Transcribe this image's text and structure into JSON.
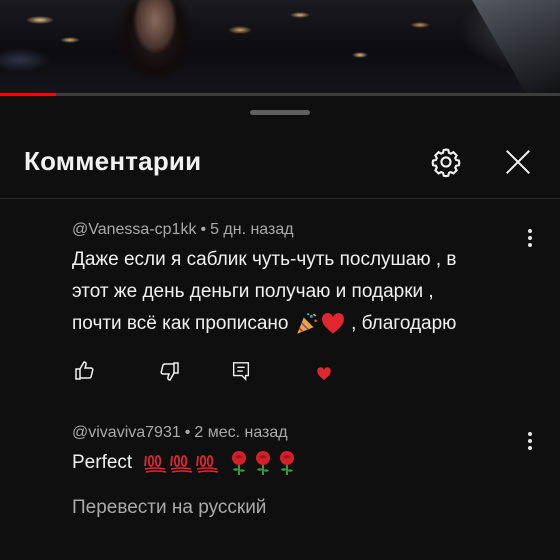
{
  "video": {
    "progress_percent": 10
  },
  "panel": {
    "title": "Комментарии"
  },
  "header_icons": {
    "settings": "gear-icon",
    "close": "close-icon"
  },
  "comments": [
    {
      "author": "@Vanessa-cp1kk",
      "separator": "•",
      "time": "5 дн. назад",
      "lines": [
        "Даже если я саблик чуть-чуть послушаю , в",
        "этот же день деньги получаю и подарки ,",
        "почти всё как прописано",
        ", благодарю"
      ],
      "actions": [
        "like-icon",
        "dislike-icon",
        "reply-icon"
      ],
      "liked_by_creator": true
    },
    {
      "author": "@vivaviva7931",
      "separator": "•",
      "time": "2 мес. назад",
      "text": "Perfect"
    }
  ],
  "translate": "Перевести на русский",
  "colors": {
    "background": "#0f0f0f",
    "accent_red": "#ff0000",
    "secondary_text": "#aaaaaa"
  }
}
